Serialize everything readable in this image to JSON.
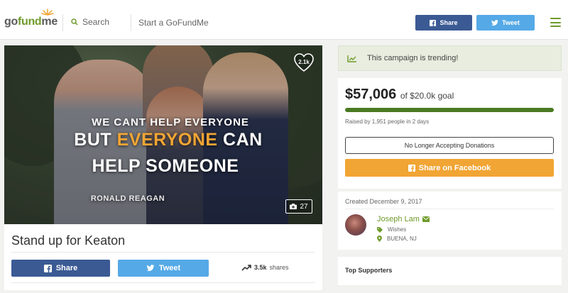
{
  "header": {
    "logo": {
      "go": "go",
      "fund": "fund",
      "me": "me"
    },
    "search_label": "Search",
    "start_label": "Start a GoFundMe",
    "share_label": "Share",
    "tweet_label": "Tweet"
  },
  "campaign": {
    "hero_text": {
      "line1": "WE CANT HELP EVERYONE",
      "line2_a": "BUT ",
      "line2_highlight": "EVERYONE",
      "line2_b": " CAN",
      "line3": "HELP SOMEONE",
      "attribution": "RONALD REAGAN"
    },
    "hearts_count": "2.1k",
    "photo_count": "27",
    "title": "Stand up for Keaton",
    "share_button": "Share",
    "tweet_button": "Tweet",
    "shares_count": "3.5k",
    "shares_label": "shares"
  },
  "sidebar": {
    "trending_text": "This campaign is trending!",
    "raised_amount": "$57,006",
    "goal_text": "of $20.0k goal",
    "progress_fraction": 1.0,
    "raised_by": "Raised by 1,951 people in 2 days",
    "no_longer_button": "No Longer Accepting Donations",
    "share_facebook_button": "Share on Facebook",
    "created": "Created December 9, 2017",
    "organizer": {
      "name": "Joseph Lam",
      "category": "Wishes",
      "location": "BUENA, NJ"
    },
    "top_supporters": "Top Supporters"
  },
  "colors": {
    "brand_green": "#6f9b2b",
    "facebook_blue": "#3b5a94",
    "twitter_blue": "#55a9e6",
    "orange": "#f1a534",
    "progress_green": "#4a7a22"
  }
}
